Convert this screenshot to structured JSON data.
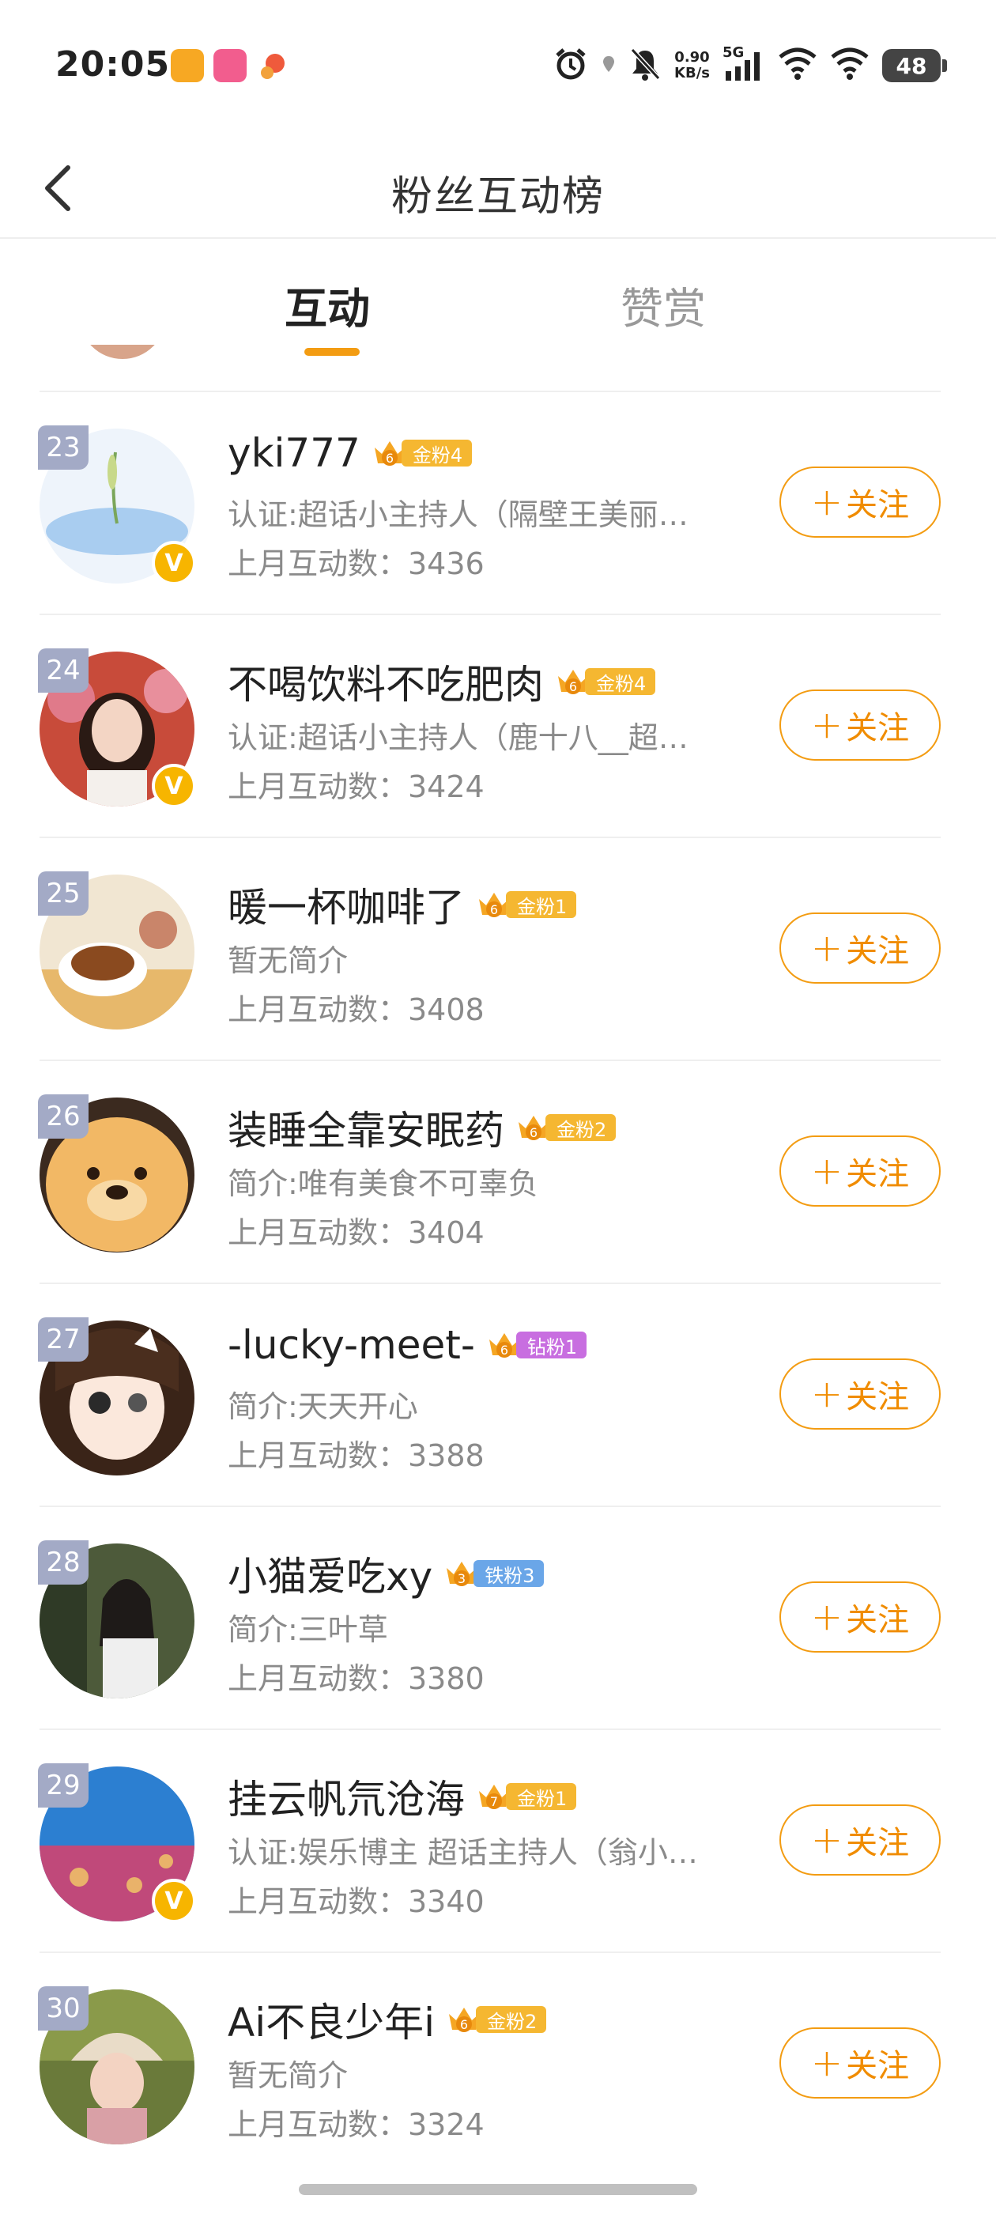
{
  "status_bar": {
    "time": "20:05",
    "net_speed_value": "0.90",
    "net_speed_unit": "KB/s",
    "network": "5G",
    "battery": "48",
    "icons": [
      "alarm-icon",
      "location-icon",
      "mute-icon",
      "signal-icon",
      "wifi-icon",
      "battery-icon"
    ]
  },
  "header": {
    "title": "粉丝互动榜"
  },
  "tabs": [
    {
      "label": "互动",
      "active": true
    },
    {
      "label": "赞赏",
      "active": false
    }
  ],
  "colors": {
    "accent": "#f39c12",
    "gold_badge": "#f5b731",
    "diamond_badge": "#c86ee0",
    "iron_badge": "#6aa6e8",
    "rank_badge": "#a3aac6"
  },
  "fans": [
    {
      "rank": "23",
      "name": "yki777",
      "badge_level": "6",
      "badge_text": "金粉4",
      "badge_type": "gold",
      "desc": "认证:超话小主持人（隔壁王美丽…",
      "count": "上月互动数：3436",
      "verified": true,
      "follow_label": "关注"
    },
    {
      "rank": "24",
      "name": "不喝饮料不吃肥肉",
      "badge_level": "6",
      "badge_text": "金粉4",
      "badge_type": "gold",
      "desc": "认证:超话小主持人（鹿十八__超…",
      "count": "上月互动数：3424",
      "verified": true,
      "follow_label": "关注"
    },
    {
      "rank": "25",
      "name": "暖一杯咖啡了",
      "badge_level": "6",
      "badge_text": "金粉1",
      "badge_type": "gold",
      "desc": "暂无简介",
      "count": "上月互动数：3408",
      "verified": false,
      "follow_label": "关注"
    },
    {
      "rank": "26",
      "name": "装睡全靠安眠药",
      "badge_level": "6",
      "badge_text": "金粉2",
      "badge_type": "gold",
      "desc": "简介:唯有美食不可辜负",
      "count": "上月互动数：3404",
      "verified": false,
      "follow_label": "关注"
    },
    {
      "rank": "27",
      "name": "-lucky-meet-",
      "badge_level": "6",
      "badge_text": "钻粉1",
      "badge_type": "diamond",
      "desc": "简介:天天开心",
      "count": "上月互动数：3388",
      "verified": false,
      "follow_label": "关注"
    },
    {
      "rank": "28",
      "name": "小猫爱吃xy",
      "badge_level": "3",
      "badge_text": "铁粉3",
      "badge_type": "iron",
      "desc": "简介:三叶草",
      "count": "上月互动数：3380",
      "verified": false,
      "follow_label": "关注"
    },
    {
      "rank": "29",
      "name": "挂云帆氘沧海",
      "badge_level": "7",
      "badge_text": "金粉1",
      "badge_type": "gold",
      "desc": "认证:娱乐博主 超话主持人（翁小…",
      "count": "上月互动数：3340",
      "verified": true,
      "follow_label": "关注"
    },
    {
      "rank": "30",
      "name": "Ai不良少年i",
      "badge_level": "6",
      "badge_text": "金粉2",
      "badge_type": "gold",
      "desc": "暂无简介",
      "count": "上月互动数：3324",
      "verified": false,
      "follow_label": "关注"
    }
  ]
}
